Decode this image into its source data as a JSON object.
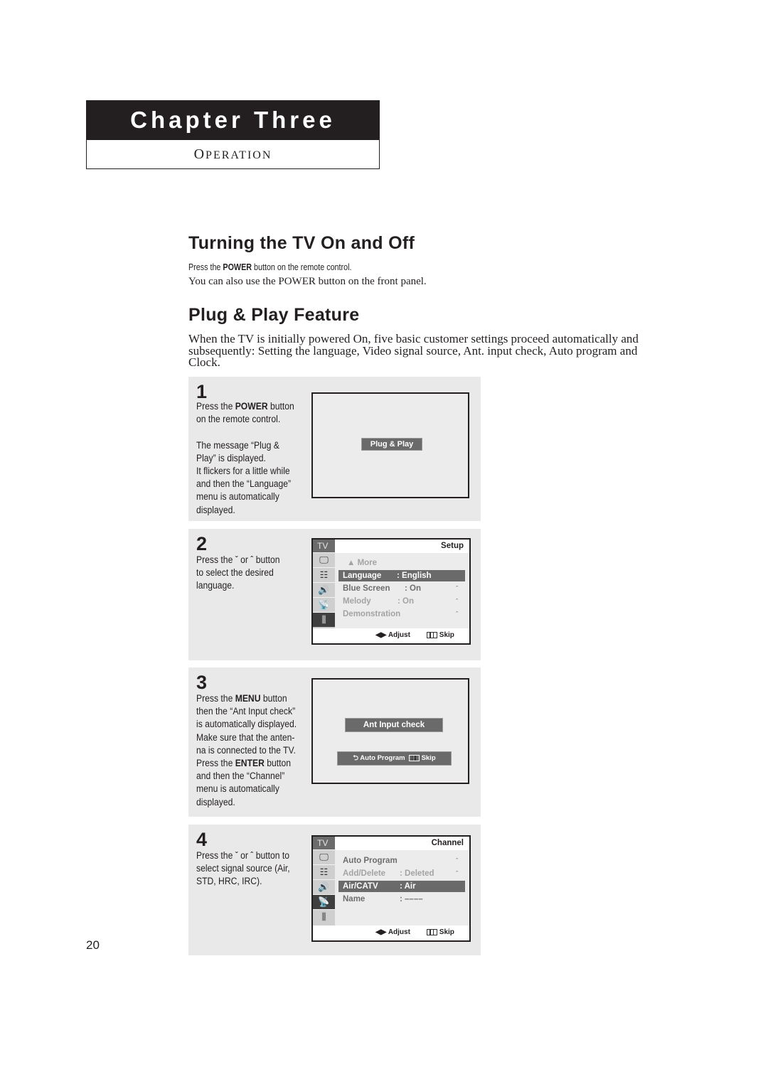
{
  "chapter": {
    "title": "Chapter Three",
    "subtitle_first": "O",
    "subtitle_rest": "PERATION"
  },
  "section1": {
    "heading": "Turning the TV On and Off",
    "line1_pre": "Press the ",
    "line1_bold": "POWER",
    "line1_post": " button on the remote control.",
    "line2": "You can also use the POWER button on the front panel."
  },
  "section2": {
    "heading": "Plug & Play Feature",
    "intro": "When the TV is initially powered On, five basic customer settings proceed automatically and subsequently: Setting the language, Video signal source, Ant. input check, Auto program and Clock."
  },
  "steps": [
    {
      "number": "1",
      "text_parts": [
        "Press the ",
        "POWER",
        " button\non the remote control.\n\nThe message “Plug &\nPlay” is displayed.\nIt flickers for a little while\nand then the “Language”\nmenu is automatically\ndisplayed."
      ],
      "osd_label": "Plug & Play"
    },
    {
      "number": "2",
      "text": "Press the ˇ  or ˆ  button\nto select the desired\nlanguage.",
      "menu": {
        "side_label": "TV",
        "title": "Setup",
        "rows": [
          {
            "label": "▲ More",
            "value": "",
            "style": "dim"
          },
          {
            "label": "Language",
            "value": ":  English",
            "style": "selected"
          },
          {
            "label": "Blue Screen",
            "value": ": On",
            "style": "normal",
            "arrow": "ˆ"
          },
          {
            "label": "Melody",
            "value": ": On",
            "style": "dim",
            "arrow": "ˆ"
          },
          {
            "label": "Demonstration",
            "value": "",
            "style": "dim",
            "arrow": "ˆ"
          }
        ],
        "footer_adjust": "Adjust",
        "footer_skip": "Skip",
        "active_icon": "setup-icon"
      }
    },
    {
      "number": "3",
      "text_parts": [
        "Press the ",
        "MENU",
        " button\nthen the “Ant Input check”\nis automatically displayed.\nMake sure that the anten-\nna is connected to the TV.\nPress the ",
        "ENTER",
        " button\nand then the “Channel”\nmenu is automatically\ndisplayed."
      ],
      "osd_label": "Ant Input check",
      "osd_bar2_auto": "Auto Program",
      "osd_bar2_skip": "Skip"
    },
    {
      "number": "4",
      "text": "Press the ˇ  or ˆ  button to\nselect signal source (Air,\nSTD, HRC, IRC).",
      "menu": {
        "side_label": "TV",
        "title": "Channel",
        "rows": [
          {
            "label": "Auto Program",
            "value": "",
            "style": "normal",
            "arrow": "ˆ"
          },
          {
            "label": "Add/Delete",
            "value": ":  Deleted",
            "style": "dim",
            "arrow": "ˆ"
          },
          {
            "label": "Air/CATV",
            "value": ":  Air",
            "style": "selected"
          },
          {
            "label": "Name",
            "value": ":  ––––",
            "style": "normal"
          }
        ],
        "footer_adjust": "Adjust",
        "footer_skip": "Skip",
        "active_icon": "antenna-icon"
      }
    }
  ],
  "page_number": "20"
}
